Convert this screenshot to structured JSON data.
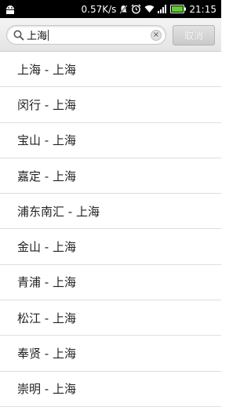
{
  "status_bar": {
    "network_speed": "0.57K/s",
    "time": "21:15",
    "icons": [
      "android-icon",
      "notification-off-icon",
      "alarm-icon",
      "wifi-icon",
      "signal-icon",
      "battery-icon"
    ]
  },
  "search": {
    "query": "上海",
    "clear_icon": "×",
    "cancel_label": "取消"
  },
  "results": [
    {
      "label": "上海  -  上海"
    },
    {
      "label": "闵行  -  上海"
    },
    {
      "label": "宝山  -  上海"
    },
    {
      "label": "嘉定  -  上海"
    },
    {
      "label": "浦东南汇  -  上海"
    },
    {
      "label": "金山  -  上海"
    },
    {
      "label": "青浦  -  上海"
    },
    {
      "label": "松江  -  上海"
    },
    {
      "label": "奉贤  -  上海"
    },
    {
      "label": "崇明  -  上海"
    }
  ],
  "colors": {
    "status_bar": "#000000",
    "battery": "#5ecb2f",
    "cancel_button": "#c9c9c9",
    "divider": "#dedede"
  }
}
